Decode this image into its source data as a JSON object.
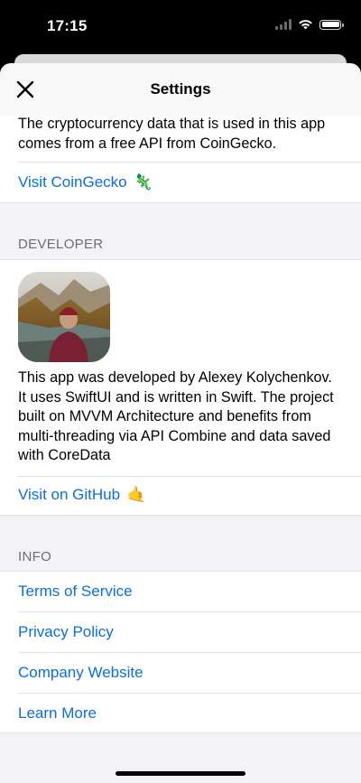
{
  "status_bar": {
    "time": "17:15"
  },
  "nav": {
    "title": "Settings"
  },
  "coingecko": {
    "description": "The cryptocurrency data that is used in this app comes from a free API from CoinGecko.",
    "link_label": "Visit CoinGecko",
    "link_emoji": "🦎"
  },
  "developer": {
    "header": "DEVELOPER",
    "description": "This app was developed by Alexey Kolychenkov. It uses SwiftUI and is written in Swift. The project built on MVVM Architecture and benefits from multi-threading via API Combine and data saved with CoreData",
    "link_label": "Visit on GitHub",
    "link_emoji": "🤙"
  },
  "info": {
    "header": "INFO",
    "items": [
      {
        "label": "Terms of Service"
      },
      {
        "label": "Privacy Policy"
      },
      {
        "label": "Company Website"
      },
      {
        "label": "Learn More"
      }
    ]
  },
  "colors": {
    "accent": "#0a6ee0",
    "grouped_background": "#f2f2f7",
    "separator": "#e3e3e6"
  }
}
